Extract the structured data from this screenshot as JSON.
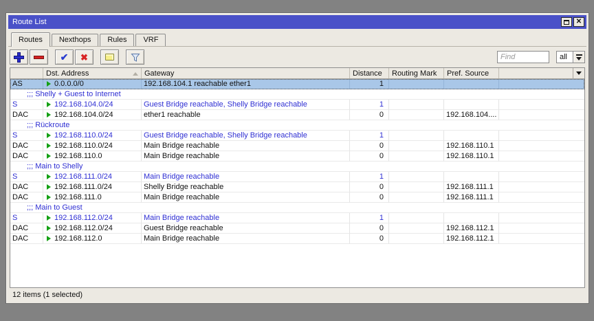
{
  "window": {
    "title": "Route List"
  },
  "tabs": [
    {
      "label": "Routes",
      "active": true
    },
    {
      "label": "Nexthops",
      "active": false
    },
    {
      "label": "Rules",
      "active": false
    },
    {
      "label": "VRF",
      "active": false
    }
  ],
  "toolbar": {
    "find_placeholder": "Find",
    "scope_value": "all"
  },
  "table": {
    "columns": [
      "",
      "Dst. Address",
      "Gateway",
      "Distance",
      "Routing Mark",
      "Pref. Source",
      ""
    ],
    "comment_prefix": ";;;",
    "rows": [
      {
        "type": "route",
        "flags": "AS",
        "dst": "0.0.0.0/0",
        "gateway": "192.168.104.1 reachable ether1",
        "distance": "1",
        "routing_mark": "",
        "pref_source": "",
        "color": "black",
        "selected": true
      },
      {
        "type": "comment",
        "text": "Shelly + Guest to Internet"
      },
      {
        "type": "route",
        "flags": "S",
        "dst": "192.168.104.0/24",
        "gateway": "Guest Bridge reachable, Shelly Bridge reachable",
        "distance": "1",
        "routing_mark": "",
        "pref_source": "",
        "color": "blue",
        "selected": false
      },
      {
        "type": "route",
        "flags": "DAC",
        "dst": "192.168.104.0/24",
        "gateway": "ether1 reachable",
        "distance": "0",
        "routing_mark": "",
        "pref_source": "192.168.104....",
        "color": "black",
        "selected": false
      },
      {
        "type": "comment",
        "text": "Rückroute"
      },
      {
        "type": "route",
        "flags": "S",
        "dst": "192.168.110.0/24",
        "gateway": "Guest Bridge reachable, Shelly Bridge reachable",
        "distance": "1",
        "routing_mark": "",
        "pref_source": "",
        "color": "blue",
        "selected": false
      },
      {
        "type": "route",
        "flags": "DAC",
        "dst": "192.168.110.0/24",
        "gateway": "Main Bridge reachable",
        "distance": "0",
        "routing_mark": "",
        "pref_source": "192.168.110.1",
        "color": "black",
        "selected": false
      },
      {
        "type": "route",
        "flags": "DAC",
        "dst": "192.168.110.0",
        "gateway": "Main Bridge reachable",
        "distance": "0",
        "routing_mark": "",
        "pref_source": "192.168.110.1",
        "color": "black",
        "selected": false
      },
      {
        "type": "comment",
        "text": "Main to Shelly"
      },
      {
        "type": "route",
        "flags": "S",
        "dst": "192.168.111.0/24",
        "gateway": "Main Bridge reachable",
        "distance": "1",
        "routing_mark": "",
        "pref_source": "",
        "color": "blue",
        "selected": false
      },
      {
        "type": "route",
        "flags": "DAC",
        "dst": "192.168.111.0/24",
        "gateway": "Shelly Bridge reachable",
        "distance": "0",
        "routing_mark": "",
        "pref_source": "192.168.111.1",
        "color": "black",
        "selected": false
      },
      {
        "type": "route",
        "flags": "DAC",
        "dst": "192.168.111.0",
        "gateway": "Main Bridge reachable",
        "distance": "0",
        "routing_mark": "",
        "pref_source": "192.168.111.1",
        "color": "black",
        "selected": false
      },
      {
        "type": "comment",
        "text": "Main to Guest"
      },
      {
        "type": "route",
        "flags": "S",
        "dst": "192.168.112.0/24",
        "gateway": "Main Bridge reachable",
        "distance": "1",
        "routing_mark": "",
        "pref_source": "",
        "color": "blue",
        "selected": false
      },
      {
        "type": "route",
        "flags": "DAC",
        "dst": "192.168.112.0/24",
        "gateway": "Guest Bridge reachable",
        "distance": "0",
        "routing_mark": "",
        "pref_source": "192.168.112.1",
        "color": "black",
        "selected": false
      },
      {
        "type": "route",
        "flags": "DAC",
        "dst": "192.168.112.0",
        "gateway": "Main Bridge reachable",
        "distance": "0",
        "routing_mark": "",
        "pref_source": "192.168.112.1",
        "color": "black",
        "selected": false
      }
    ]
  },
  "statusbar": {
    "text": "12 items (1 selected)"
  },
  "colors": {
    "titlebar": "#4a51c8",
    "selected_row": "#a9c7e8",
    "route_blue": "#2f2fd3",
    "active_flag_green": "#14a014"
  }
}
